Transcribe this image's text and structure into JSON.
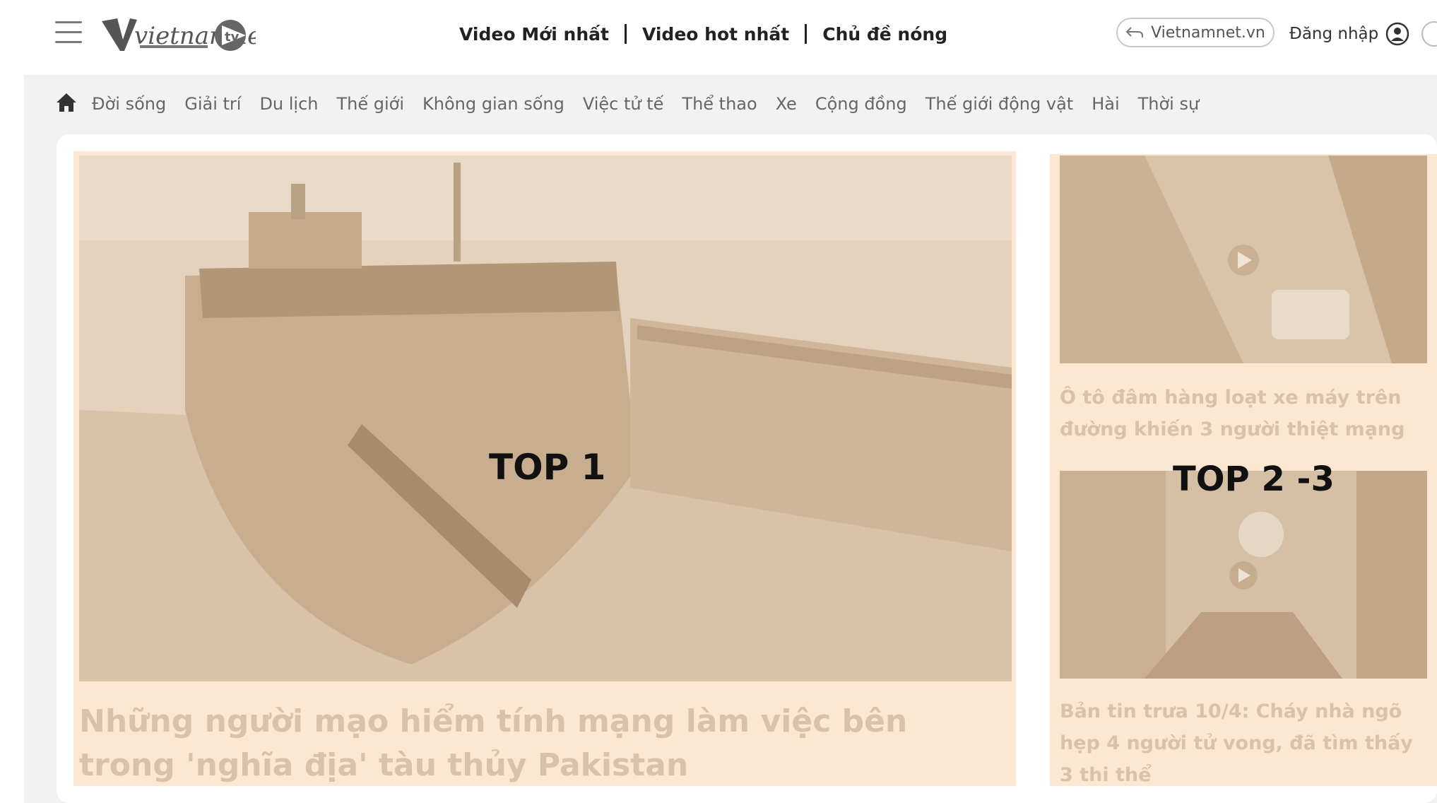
{
  "header": {
    "logo_text": "vietnamnet tv",
    "nav": [
      "Video Mới nhất",
      "Video hot nhất",
      "Chủ đề nóng"
    ],
    "site_button": "Vietnamnet.vn",
    "login": "Đăng nhập"
  },
  "categories": [
    "Đời sống",
    "Giải trí",
    "Du lịch",
    "Thế giới",
    "Không gian sống",
    "Việc tử tế",
    "Thể thao",
    "Xe",
    "Cộng đồng",
    "Thế giới động vật",
    "Hài",
    "Thời sự"
  ],
  "main": {
    "overlay_label": "TOP 1",
    "title": "Những người mạo hiểm tính mạng làm việc bên trong 'nghĩa địa' tàu thủy Pakistan"
  },
  "side": {
    "overlay_label": "TOP 2 -3",
    "items": [
      {
        "title": "Ô tô đâm hàng loạt xe máy trên đường khiến 3 người thiệt mạng"
      },
      {
        "title": "Bản tin trưa 10/4: Cháy nhà ngõ hẹp 4 người tử vong, đã tìm thấy 3 thi thể"
      }
    ]
  },
  "colors": {
    "highlight_bg": "#fbe7d2",
    "faded_text": "#d8c2ab",
    "category_bar": "#f2f2f2"
  }
}
